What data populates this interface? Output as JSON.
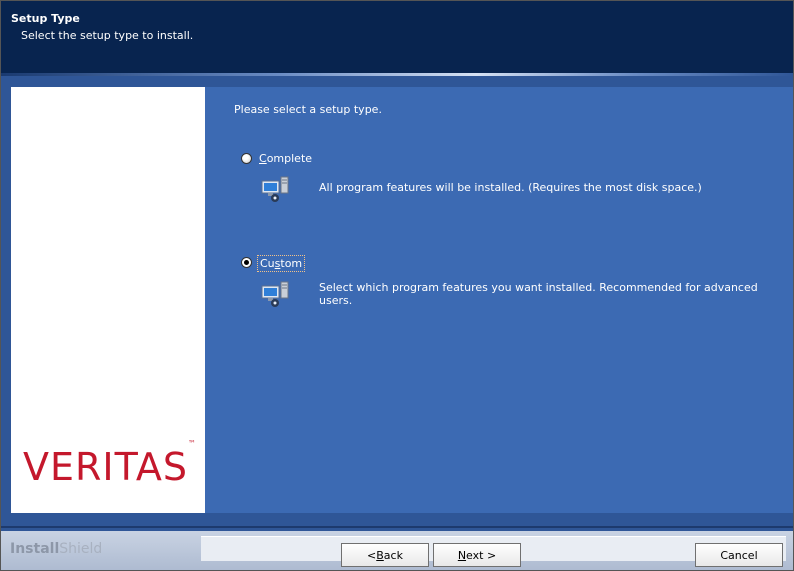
{
  "header": {
    "title": "Setup Type",
    "subtitle": "Select the setup type to install."
  },
  "sidebar": {
    "logo_text": "VERITAS",
    "logo_tm": "™"
  },
  "main": {
    "prompt": "Please select a setup type.",
    "options": [
      {
        "label_pre": "",
        "label_accel": "C",
        "label_post": "omplete",
        "description": "All program features will be installed. (Requires the most disk space.)",
        "selected": false,
        "icon": "computer-install-icon"
      },
      {
        "label_pre": "Cu",
        "label_accel": "s",
        "label_post": "tom",
        "description": "Select which program features you want installed. Recommended for advanced users.",
        "selected": true,
        "icon": "computer-install-icon"
      }
    ]
  },
  "footer": {
    "brand_bold": "Install",
    "brand_light": "Shield",
    "back_pre": "< ",
    "back_accel": "B",
    "back_post": "ack",
    "next_accel": "N",
    "next_post": "ext >",
    "cancel_label": "Cancel"
  },
  "colors": {
    "header_bg": "#08244f",
    "content_bg": "#3c6ab3",
    "logo_red": "#c4182c"
  }
}
